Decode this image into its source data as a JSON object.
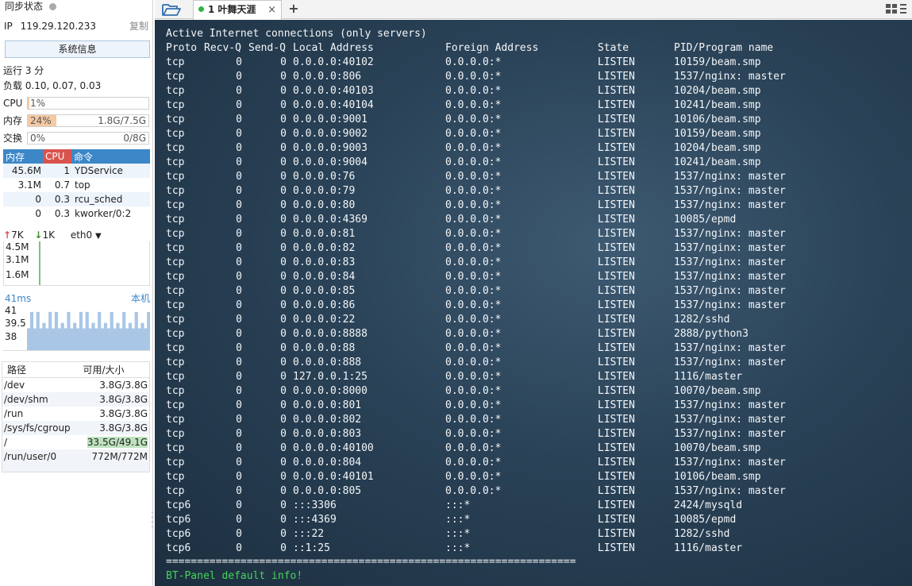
{
  "sidebar": {
    "sync_status": "同步状态",
    "ip_label": "IP",
    "ip": "119.29.120.233",
    "copy": "复制",
    "sysinfo_button": "系统信息",
    "uptime": "运行 3 分",
    "load": "负载 0.10, 0.07, 0.03",
    "cpu": {
      "label": "CPU",
      "percent": "1%",
      "fraction": 0.01
    },
    "memory": {
      "label": "内存",
      "percent": "24%",
      "fraction": 0.24,
      "value": "1.8G/7.5G"
    },
    "swap": {
      "label": "交换",
      "percent": "0%",
      "fraction": 0.0,
      "value": "0/8G"
    },
    "process_table": {
      "headers": [
        "内存",
        "CPU",
        "命令"
      ],
      "rows": [
        [
          "45.6M",
          "1",
          "YDService"
        ],
        [
          "3.1M",
          "0.7",
          "top"
        ],
        [
          "0",
          "0.3",
          "rcu_sched"
        ],
        [
          "0",
          "0.3",
          "kworker/0:2"
        ]
      ]
    },
    "network": {
      "up": "7K",
      "down": "1K",
      "interface": "eth0",
      "scale": [
        "4.5M",
        "3.1M",
        "1.6M"
      ]
    },
    "latency": {
      "value": "41ms",
      "target": "本机",
      "scale": [
        "41",
        "39.5",
        "38"
      ],
      "samples": [
        39.5,
        41,
        39.5,
        41,
        39.5,
        40,
        39.5,
        41,
        39.5,
        41,
        39.5,
        40,
        39.5,
        41,
        39.5,
        40,
        39.5,
        41,
        39.5,
        41,
        39.5,
        40,
        39.5,
        41,
        39.5,
        40,
        39.5,
        41,
        39.5,
        40,
        39.5,
        41,
        39.5,
        40,
        39.5,
        41,
        39.5,
        40,
        39.5,
        41
      ]
    },
    "disk_table": {
      "headers": [
        "路径",
        "可用/大小"
      ],
      "rows": [
        [
          "/dev",
          "3.8G/3.8G"
        ],
        [
          "/dev/shm",
          "3.8G/3.8G"
        ],
        [
          "/run",
          "3.8G/3.8G"
        ],
        [
          "/sys/fs/cgroup",
          "3.8G/3.8G"
        ],
        [
          "/",
          "33.5G/49.1G"
        ],
        [
          "/run/user/0",
          "772M/772M"
        ]
      ]
    }
  },
  "tabs": {
    "active_label": "1 叶舞天涯",
    "close": "×",
    "add": "+"
  },
  "terminal": {
    "title_line": "Active Internet connections (only servers)",
    "headers": {
      "proto": "Proto",
      "recv": "Recv-Q",
      "send": "Send-Q",
      "local": "Local Address",
      "foreign": "Foreign Address",
      "state": "State",
      "pid": "PID/Program name"
    },
    "rows": [
      [
        "tcp",
        "0",
        "0",
        "0.0.0.0:40102",
        "0.0.0.0:*",
        "LISTEN",
        "10159/beam.smp"
      ],
      [
        "tcp",
        "0",
        "0",
        "0.0.0.0:806",
        "0.0.0.0:*",
        "LISTEN",
        "1537/nginx: master"
      ],
      [
        "tcp",
        "0",
        "0",
        "0.0.0.0:40103",
        "0.0.0.0:*",
        "LISTEN",
        "10204/beam.smp"
      ],
      [
        "tcp",
        "0",
        "0",
        "0.0.0.0:40104",
        "0.0.0.0:*",
        "LISTEN",
        "10241/beam.smp"
      ],
      [
        "tcp",
        "0",
        "0",
        "0.0.0.0:9001",
        "0.0.0.0:*",
        "LISTEN",
        "10106/beam.smp"
      ],
      [
        "tcp",
        "0",
        "0",
        "0.0.0.0:9002",
        "0.0.0.0:*",
        "LISTEN",
        "10159/beam.smp"
      ],
      [
        "tcp",
        "0",
        "0",
        "0.0.0.0:9003",
        "0.0.0.0:*",
        "LISTEN",
        "10204/beam.smp"
      ],
      [
        "tcp",
        "0",
        "0",
        "0.0.0.0:9004",
        "0.0.0.0:*",
        "LISTEN",
        "10241/beam.smp"
      ],
      [
        "tcp",
        "0",
        "0",
        "0.0.0.0:76",
        "0.0.0.0:*",
        "LISTEN",
        "1537/nginx: master"
      ],
      [
        "tcp",
        "0",
        "0",
        "0.0.0.0:79",
        "0.0.0.0:*",
        "LISTEN",
        "1537/nginx: master"
      ],
      [
        "tcp",
        "0",
        "0",
        "0.0.0.0:80",
        "0.0.0.0:*",
        "LISTEN",
        "1537/nginx: master"
      ],
      [
        "tcp",
        "0",
        "0",
        "0.0.0.0:4369",
        "0.0.0.0:*",
        "LISTEN",
        "10085/epmd"
      ],
      [
        "tcp",
        "0",
        "0",
        "0.0.0.0:81",
        "0.0.0.0:*",
        "LISTEN",
        "1537/nginx: master"
      ],
      [
        "tcp",
        "0",
        "0",
        "0.0.0.0:82",
        "0.0.0.0:*",
        "LISTEN",
        "1537/nginx: master"
      ],
      [
        "tcp",
        "0",
        "0",
        "0.0.0.0:83",
        "0.0.0.0:*",
        "LISTEN",
        "1537/nginx: master"
      ],
      [
        "tcp",
        "0",
        "0",
        "0.0.0.0:84",
        "0.0.0.0:*",
        "LISTEN",
        "1537/nginx: master"
      ],
      [
        "tcp",
        "0",
        "0",
        "0.0.0.0:85",
        "0.0.0.0:*",
        "LISTEN",
        "1537/nginx: master"
      ],
      [
        "tcp",
        "0",
        "0",
        "0.0.0.0:86",
        "0.0.0.0:*",
        "LISTEN",
        "1537/nginx: master"
      ],
      [
        "tcp",
        "0",
        "0",
        "0.0.0.0:22",
        "0.0.0.0:*",
        "LISTEN",
        "1282/sshd"
      ],
      [
        "tcp",
        "0",
        "0",
        "0.0.0.0:8888",
        "0.0.0.0:*",
        "LISTEN",
        "2888/python3"
      ],
      [
        "tcp",
        "0",
        "0",
        "0.0.0.0:88",
        "0.0.0.0:*",
        "LISTEN",
        "1537/nginx: master"
      ],
      [
        "tcp",
        "0",
        "0",
        "0.0.0.0:888",
        "0.0.0.0:*",
        "LISTEN",
        "1537/nginx: master"
      ],
      [
        "tcp",
        "0",
        "0",
        "127.0.0.1:25",
        "0.0.0.0:*",
        "LISTEN",
        "1116/master"
      ],
      [
        "tcp",
        "0",
        "0",
        "0.0.0.0:8000",
        "0.0.0.0:*",
        "LISTEN",
        "10070/beam.smp"
      ],
      [
        "tcp",
        "0",
        "0",
        "0.0.0.0:801",
        "0.0.0.0:*",
        "LISTEN",
        "1537/nginx: master"
      ],
      [
        "tcp",
        "0",
        "0",
        "0.0.0.0:802",
        "0.0.0.0:*",
        "LISTEN",
        "1537/nginx: master"
      ],
      [
        "tcp",
        "0",
        "0",
        "0.0.0.0:803",
        "0.0.0.0:*",
        "LISTEN",
        "1537/nginx: master"
      ],
      [
        "tcp",
        "0",
        "0",
        "0.0.0.0:40100",
        "0.0.0.0:*",
        "LISTEN",
        "10070/beam.smp"
      ],
      [
        "tcp",
        "0",
        "0",
        "0.0.0.0:804",
        "0.0.0.0:*",
        "LISTEN",
        "1537/nginx: master"
      ],
      [
        "tcp",
        "0",
        "0",
        "0.0.0.0:40101",
        "0.0.0.0:*",
        "LISTEN",
        "10106/beam.smp"
      ],
      [
        "tcp",
        "0",
        "0",
        "0.0.0.0:805",
        "0.0.0.0:*",
        "LISTEN",
        "1537/nginx: master"
      ],
      [
        "tcp6",
        "0",
        "0",
        ":::3306",
        ":::*",
        "LISTEN",
        "2424/mysqld"
      ],
      [
        "tcp6",
        "0",
        "0",
        ":::4369",
        ":::*",
        "LISTEN",
        "10085/epmd"
      ],
      [
        "tcp6",
        "0",
        "0",
        ":::22",
        ":::*",
        "LISTEN",
        "1282/sshd"
      ],
      [
        "tcp6",
        "0",
        "0",
        "::1:25",
        ":::*",
        "LISTEN",
        "1116/master"
      ]
    ],
    "separator": "==================================================================",
    "footer_line": "BT-Panel default info!"
  },
  "colors": {
    "accent_blue": "#3c87c8",
    "cpu_red": "#d9534f",
    "status_green": "#2fb344",
    "terminal_green": "#45d45a",
    "latency_fill": "#a9c6e6"
  },
  "icons": [
    "folder-open-icon",
    "status-dot-icon",
    "close-icon",
    "plus-icon",
    "arrow-up-icon",
    "arrow-down-icon",
    "chevron-down-icon",
    "grid-icon"
  ]
}
